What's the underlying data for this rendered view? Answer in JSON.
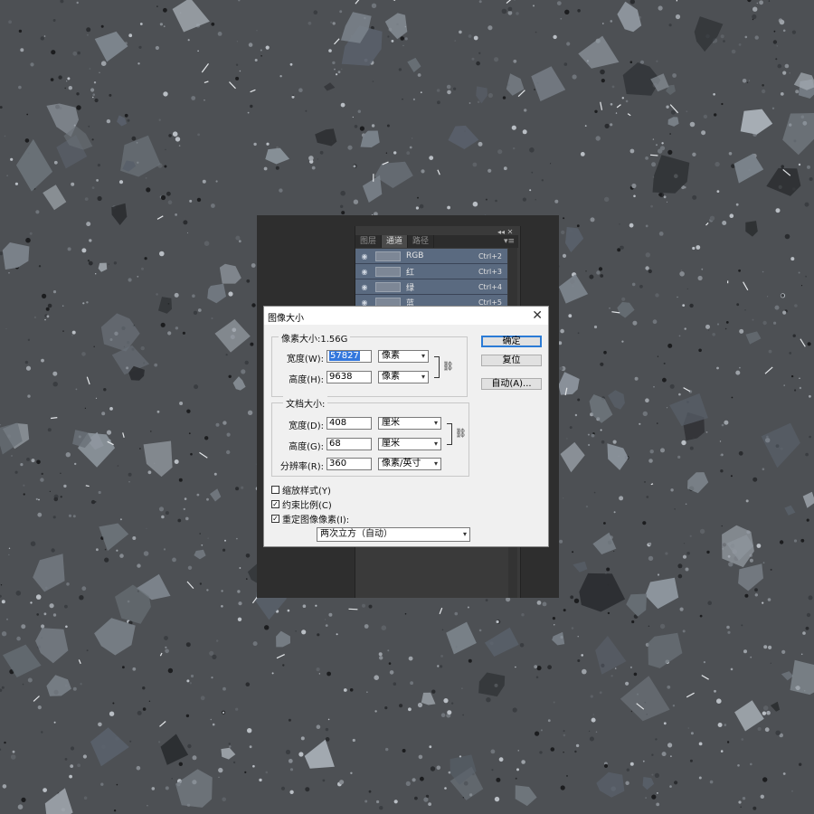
{
  "panel": {
    "tabs": [
      "图层",
      "通道",
      "路径"
    ],
    "active_tab": 1,
    "channels": [
      {
        "name": "RGB",
        "shortcut": "Ctrl+2"
      },
      {
        "name": "红",
        "shortcut": "Ctrl+3"
      },
      {
        "name": "绿",
        "shortcut": "Ctrl+4"
      },
      {
        "name": "蓝",
        "shortcut": "Ctrl+5"
      }
    ]
  },
  "dialog": {
    "title": "图像大小",
    "close_label": "✕",
    "pixel_dimensions": {
      "legend": "像素大小:1.56G",
      "width_label": "宽度(W):",
      "width_value": "57827",
      "width_unit": "像素",
      "height_label": "高度(H):",
      "height_value": "9638",
      "height_unit": "像素"
    },
    "document_size": {
      "legend": "文档大小:",
      "width_label": "宽度(D):",
      "width_value": "408",
      "width_unit": "厘米",
      "height_label": "高度(G):",
      "height_value": "68",
      "height_unit": "厘米",
      "resolution_label": "分辨率(R):",
      "resolution_value": "360",
      "resolution_unit": "像素/英寸"
    },
    "buttons": {
      "ok": "确定",
      "reset": "复位",
      "auto": "自动(A)..."
    },
    "options": {
      "scale_styles": {
        "label": "缩放样式(Y)",
        "checked": false
      },
      "constrain_proportions": {
        "label": "约束比例(C)",
        "checked": true
      },
      "resample": {
        "label": "重定图像像素(I):",
        "checked": true
      }
    },
    "resample_method": "两次立方（自动）"
  }
}
